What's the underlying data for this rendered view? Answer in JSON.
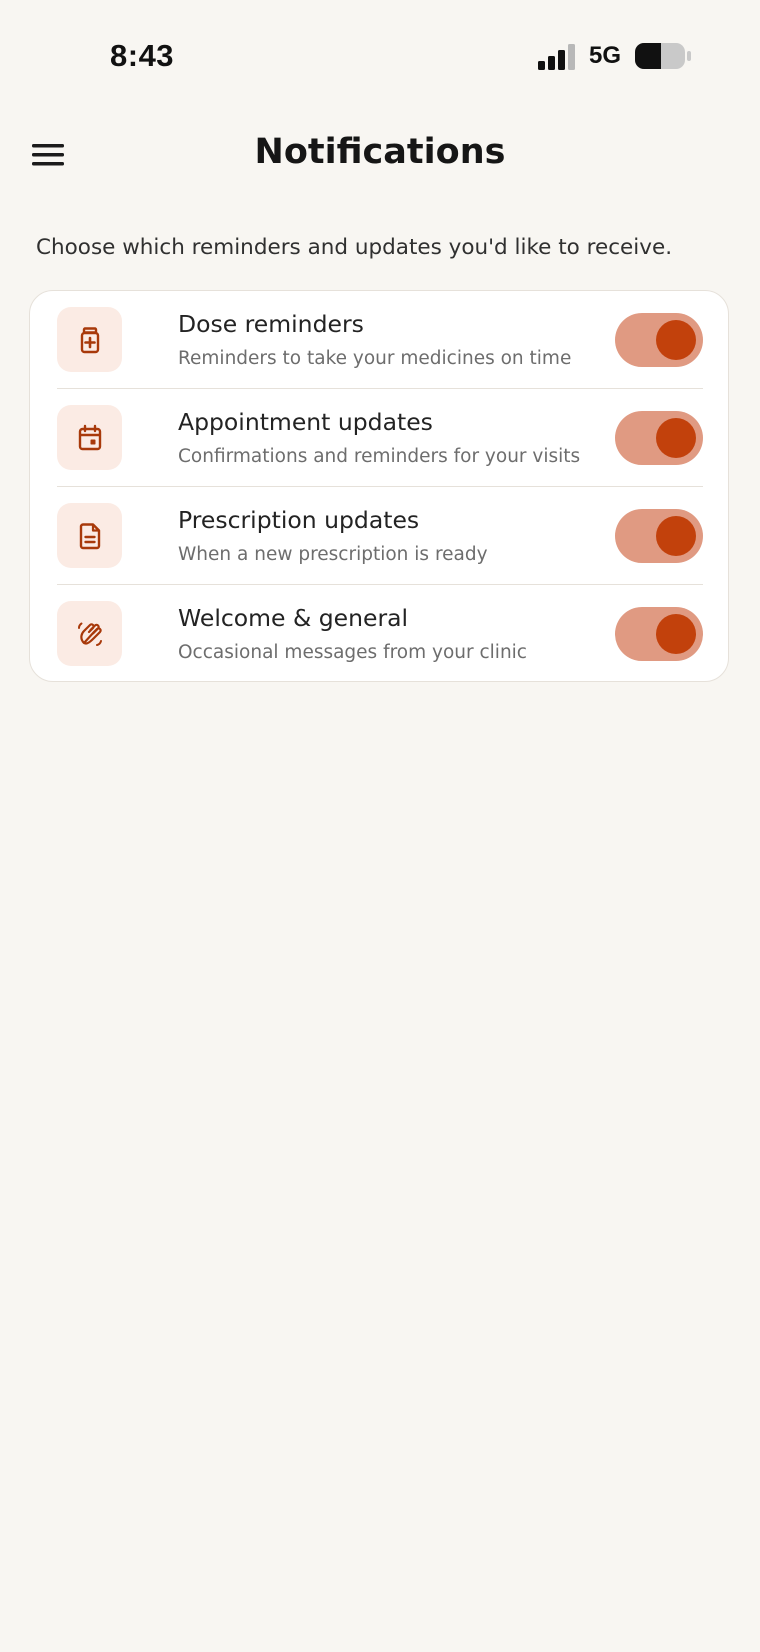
{
  "status_bar": {
    "time": "8:43",
    "network": "5G",
    "signal_icon": "cellular-signal-icon",
    "battery_icon": "battery-icon"
  },
  "header": {
    "title": "Notifications",
    "menu_icon": "hamburger-menu-icon"
  },
  "intro": "Choose which reminders and updates you'd like to receive.",
  "settings": [
    {
      "title": "Dose reminders",
      "description": "Reminders to take your medicines on time",
      "icon": "medicine-bottle-icon",
      "enabled": true
    },
    {
      "title": "Appointment updates",
      "description": "Confirmations and reminders for your visits",
      "icon": "calendar-icon",
      "enabled": true
    },
    {
      "title": "Prescription updates",
      "description": "When a new prescription is ready",
      "icon": "document-icon",
      "enabled": true
    },
    {
      "title": "Welcome & general",
      "description": "Occasional messages from your clinic",
      "icon": "waving-hand-icon",
      "enabled": true
    }
  ],
  "colors": {
    "background": "#f8f6f2",
    "accent": "#c2410c",
    "toggle_track": "#e09a82",
    "icon_tile": "#fbebe4"
  }
}
